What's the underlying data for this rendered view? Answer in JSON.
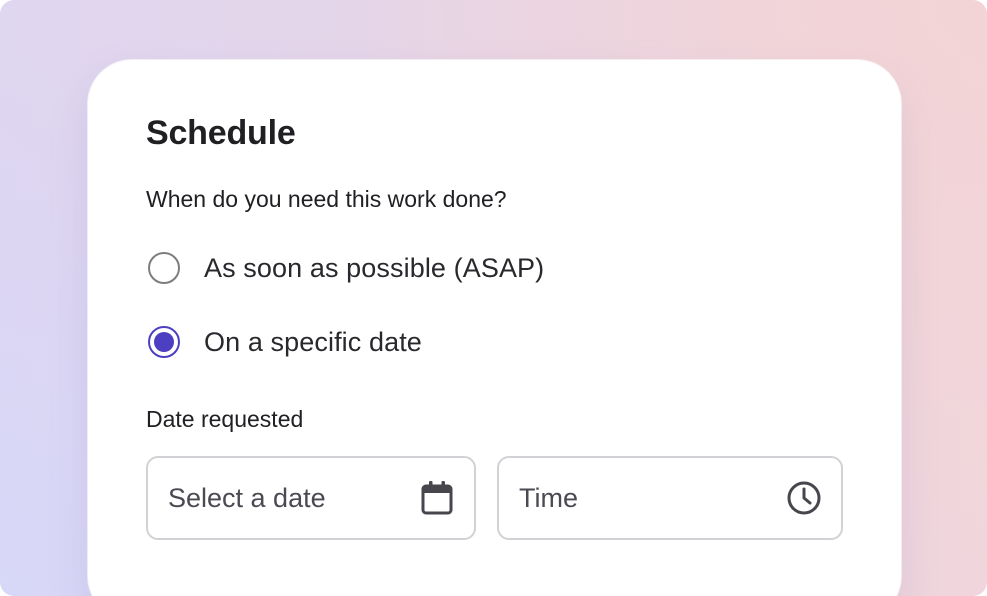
{
  "schedule": {
    "title": "Schedule",
    "question": "When do you need this work done?",
    "options": [
      {
        "label": "As soon as possible (ASAP)",
        "selected": false
      },
      {
        "label": "On a specific date",
        "selected": true
      }
    ],
    "date_requested_label": "Date requested",
    "date_field": {
      "placeholder": "Select a date",
      "icon": "calendar-icon"
    },
    "time_field": {
      "placeholder": "Time",
      "icon": "clock-icon"
    }
  },
  "colors": {
    "accent": "#4d3fc1",
    "radio_border": "#7d7d80",
    "field_border": "#d2d2d6",
    "text": "#202024"
  }
}
